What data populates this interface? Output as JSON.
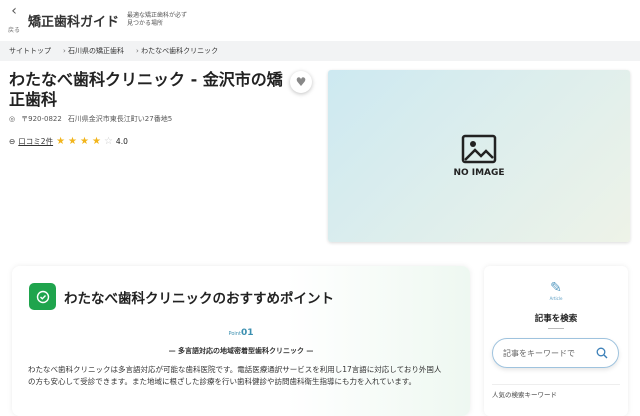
{
  "header": {
    "back_label": "戻る",
    "logo": "矯正歯科ガイド",
    "tagline": "最適な矯正歯科が必ず見つかる場所"
  },
  "breadcrumb": [
    "サイトトップ",
    "石川県の矯正歯科",
    "わたなべ歯科クリニック"
  ],
  "clinic": {
    "title": "わたなべ歯科クリニック - 金沢市の矯正歯科",
    "postal": "〒920-0822",
    "address": "石川県金沢市東長江町い27番地5",
    "reviews_link": "口コミ2件",
    "rating": 4.0,
    "rating_text": "4.0",
    "no_image": "NO IMAGE"
  },
  "recommend": {
    "heading": "わたなべ歯科クリニックのおすすめポイント",
    "point_label": "Point",
    "point_num": "01",
    "point_title": "多言語対応の地域密着型歯科クリニック",
    "body": "わたなべ歯科クリニックは多言語対応が可能な歯科医院です。電話医療通訳サービスを利用し17言語に対応しており外国人の方も安心して受診できます。また地域に根ざした診療を行い歯科健診や訪問歯科衛生指導にも力を入れています。"
  },
  "sidebar": {
    "article_label": "Article",
    "heading": "記事を検索",
    "search_placeholder": "記事をキーワードで",
    "popular": "人気の検索キーワード"
  },
  "colors": {
    "accent_green": "#1fa44d",
    "star": "#f2b51c"
  }
}
